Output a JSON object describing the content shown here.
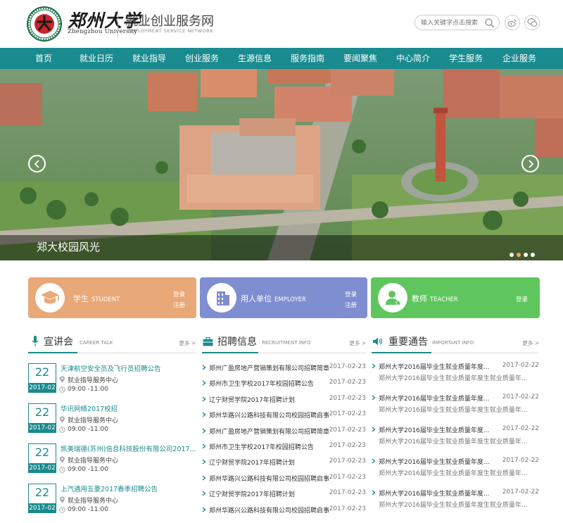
{
  "header": {
    "logo_cn": "郑州大学",
    "logo_en": "Zhengzhou University",
    "site_title": "就业创业服务网",
    "site_subtitle": "EMPLOYMENT SERVICE NETWORK",
    "search_placeholder": "输入关键字点击搜索",
    "social": [
      "weibo-icon",
      "wechat-icon"
    ]
  },
  "nav": [
    "首页",
    "就业日历",
    "就业指导",
    "创业服务",
    "生源信息",
    "服务指南",
    "要闻聚焦",
    "中心简介",
    "学生服务",
    "企业服务"
  ],
  "banner": {
    "caption": "郑大校园风光",
    "slide_count": 4,
    "active_slide": 2
  },
  "cards": [
    {
      "title": "学生",
      "title_en": "STUDENT",
      "links": [
        "登录",
        "注册"
      ],
      "color": "#e9a877"
    },
    {
      "title": "用人单位",
      "title_en": "EMPLOYER",
      "links": [
        "登录",
        "注册"
      ],
      "color": "#7e8ed0"
    },
    {
      "title": "教师",
      "title_en": "TEACHER",
      "links": [
        "登录"
      ],
      "color": "#5ec65c"
    }
  ],
  "sections": {
    "talks": {
      "title": "宣讲会",
      "title_en": "CAREER TALK",
      "more": "更多 >",
      "items": [
        {
          "day": "22",
          "ym": "2017-02",
          "title": "天津航空安全员及飞行员招聘公告",
          "place": "就业指导服务中心",
          "time": "09:00 -11:00"
        },
        {
          "day": "22",
          "ym": "2017-02",
          "title": "华讯网络2017校招",
          "place": "就业指导服务中心",
          "time": "09:00 -11:00"
        },
        {
          "day": "22",
          "ym": "2017-02",
          "title": "凯美瑞德(苏州)信息科技股份有限公司2017...",
          "place": "就业指导服务中心",
          "time": "09:00 -11:00"
        },
        {
          "day": "22",
          "ym": "2017-02",
          "title": "上汽通用五菱2017春季招聘公告",
          "place": "就业指导服务中心",
          "time": "09:00 -11:00"
        }
      ]
    },
    "recruit": {
      "title": "招聘信息",
      "title_en": "RECRUITMENT INFO",
      "more": "更多 >",
      "items": [
        {
          "title": "郑州广盈房地产营销策划有限公司招聘简章",
          "date": "2017-02-23"
        },
        {
          "title": "郑州市卫生学校2017年校园招聘公告",
          "date": "2017-02-23"
        },
        {
          "title": "辽宁财贸学院2017年招聘计划",
          "date": "2017-02-23"
        },
        {
          "title": "郑州华路兴公路科技有限公司校园招聘启事",
          "date": "2017-02-23"
        },
        {
          "title": "郑州广盈房地产营销策划有限公司招聘简章",
          "date": "2017-02-23"
        },
        {
          "title": "郑州市卫生学校2017年校园招聘公告",
          "date": "2017-02-23"
        },
        {
          "title": "辽宁财贸学院2017年招聘计划",
          "date": "2017-02-23"
        },
        {
          "title": "郑州华路兴公路科技有限公司校园招聘启事",
          "date": "2017-02-23"
        },
        {
          "title": "辽宁财贸学院2017年招聘计划",
          "date": "2017-02-23"
        },
        {
          "title": "郑州华路兴公路科技有限公司校园招聘启事",
          "date": "2017-02-23"
        }
      ]
    },
    "notices": {
      "title": "重要通告",
      "title_en": "IMPORTANT INFO",
      "more": "更多 >",
      "items": [
        {
          "title": "郑州大学2016届毕业生就业质量年度...",
          "date": "2017-02-22",
          "summary": "郑州大学2016届毕业生就业质量年度生就业质量年..."
        },
        {
          "title": "郑州大学2016届毕业生就业质量年度...",
          "date": "2017-02-22",
          "summary": "郑州大学2016届毕业生就业质量年度生就业质量年..."
        },
        {
          "title": "郑州大学2016届毕业生就业质量年度...",
          "date": "2017-02-22",
          "summary": "郑州大学2016届毕业生就业质量年度生就业质量年..."
        },
        {
          "title": "郑州大学2016届毕业生就业质量年度...",
          "date": "2017-02-22",
          "summary": "郑州大学2016届毕业生就业质量年度生就业质量年..."
        },
        {
          "title": "郑州大学2016届毕业生就业质量年度...",
          "date": "2017-02-22",
          "summary": "郑州大学2016届毕业生就业质量年度生就业质量年..."
        }
      ]
    }
  },
  "colors": {
    "teal": "#1a8b8f",
    "orange": "#e9a877",
    "purple": "#7e8ed0",
    "green": "#5ec65c"
  }
}
